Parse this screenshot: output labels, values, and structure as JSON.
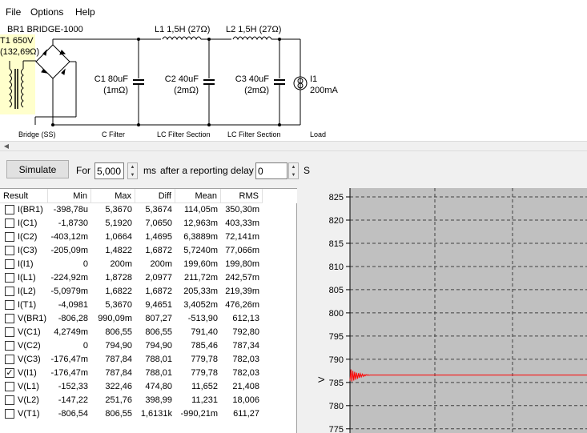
{
  "menu": {
    "file": "File",
    "options": "Options",
    "help": "Help"
  },
  "schematic": {
    "bridge_title": "BR1 BRIDGE-1000",
    "t1_label": "T1 650V",
    "t1_resistance": "(132,69Ω)",
    "l1_label": "L1 1,5H (27Ω)",
    "l2_label": "L2 1,5H (27Ω)",
    "c1_label": "C1 80uF",
    "c1_esr": "(1mΩ)",
    "c2_label": "C2 40uF",
    "c2_esr": "(2mΩ)",
    "c3_label": "C3 40uF",
    "c3_esr": "(2mΩ)",
    "i1_label": "I1",
    "i1_value": "200mA",
    "sections": {
      "bridge": "Bridge (SS)",
      "cfilter": "C Filter",
      "lc1": "LC Filter Section",
      "lc2": "LC Filter Section",
      "load": "Load"
    }
  },
  "sim": {
    "simulate_label": "Simulate",
    "for_label": "For",
    "duration": "5,000",
    "ms_label": "ms",
    "delay_label": "after a reporting delay of",
    "delay": "0",
    "s_label": "S"
  },
  "results": {
    "columns": [
      "Result",
      "Min",
      "Max",
      "Diff",
      "Mean",
      "RMS"
    ],
    "rows": [
      {
        "name": "I(BR1)",
        "checked": false,
        "min": "-398,78u",
        "max": "5,3670",
        "diff": "5,3674",
        "mean": "114,05m",
        "rms": "350,30m"
      },
      {
        "name": "I(C1)",
        "checked": false,
        "min": "-1,8730",
        "max": "5,1920",
        "diff": "7,0650",
        "mean": "12,963m",
        "rms": "403,33m"
      },
      {
        "name": "I(C2)",
        "checked": false,
        "min": "-403,12m",
        "max": "1,0664",
        "diff": "1,4695",
        "mean": "6,3889m",
        "rms": "72,141m"
      },
      {
        "name": "I(C3)",
        "checked": false,
        "min": "-205,09m",
        "max": "1,4822",
        "diff": "1,6872",
        "mean": "5,7240m",
        "rms": "77,066m"
      },
      {
        "name": "I(I1)",
        "checked": false,
        "min": "0",
        "max": "200m",
        "diff": "200m",
        "mean": "199,60m",
        "rms": "199,80m"
      },
      {
        "name": "I(L1)",
        "checked": false,
        "min": "-224,92m",
        "max": "1,8728",
        "diff": "2,0977",
        "mean": "211,72m",
        "rms": "242,57m"
      },
      {
        "name": "I(L2)",
        "checked": false,
        "min": "-5,0979m",
        "max": "1,6822",
        "diff": "1,6872",
        "mean": "205,33m",
        "rms": "219,39m"
      },
      {
        "name": "I(T1)",
        "checked": false,
        "min": "-4,0981",
        "max": "5,3670",
        "diff": "9,4651",
        "mean": "3,4052m",
        "rms": "476,26m"
      },
      {
        "name": "V(BR1)",
        "checked": false,
        "min": "-806,28",
        "max": "990,09m",
        "diff": "807,27",
        "mean": "-513,90",
        "rms": "612,13"
      },
      {
        "name": "V(C1)",
        "checked": false,
        "min": "4,2749m",
        "max": "806,55",
        "diff": "806,55",
        "mean": "791,40",
        "rms": "792,80"
      },
      {
        "name": "V(C2)",
        "checked": false,
        "min": "0",
        "max": "794,90",
        "diff": "794,90",
        "mean": "785,46",
        "rms": "787,34"
      },
      {
        "name": "V(C3)",
        "checked": false,
        "min": "-176,47m",
        "max": "787,84",
        "diff": "788,01",
        "mean": "779,78",
        "rms": "782,03"
      },
      {
        "name": "V(I1)",
        "checked": true,
        "min": "-176,47m",
        "max": "787,84",
        "diff": "788,01",
        "mean": "779,78",
        "rms": "782,03"
      },
      {
        "name": "V(L1)",
        "checked": false,
        "min": "-152,33",
        "max": "322,46",
        "diff": "474,80",
        "mean": "11,652",
        "rms": "21,408"
      },
      {
        "name": "V(L2)",
        "checked": false,
        "min": "-147,22",
        "max": "251,76",
        "diff": "398,99",
        "mean": "11,231",
        "rms": "18,006"
      },
      {
        "name": "V(T1)",
        "checked": false,
        "min": "-806,54",
        "max": "806,55",
        "diff": "1,6131k",
        "mean": "-990,21m",
        "rms": "611,27"
      }
    ]
  },
  "chart_data": {
    "type": "line",
    "ylabel": "V",
    "yticks": [
      825,
      820,
      815,
      810,
      805,
      800,
      795,
      790,
      785,
      780,
      775
    ],
    "ylim": [
      775,
      826
    ],
    "grid": true,
    "series": [
      {
        "color": "#ff0000",
        "x": [
          0,
          0.4,
          0.8,
          1.2,
          1.6,
          2.0,
          2.4,
          2.8,
          3.2,
          3.6,
          4.0,
          4.4,
          4.8,
          5.2,
          5.6,
          6.0,
          6.4,
          6.8,
          7.2,
          7.6,
          8.0,
          8.4,
          8.8,
          9.2,
          9.6,
          10.0,
          10.4,
          10.8,
          11.2,
          11.6,
          12.0,
          12.4,
          12.8,
          13.2,
          13.6,
          14.0,
          15.0,
          20,
          30,
          40,
          50,
          60,
          70,
          80,
          90,
          100
        ],
        "y": [
          785.4,
          787.8,
          785.2,
          787.5,
          785.4,
          787.3,
          785.6,
          787.1,
          785.8,
          787.0,
          786.0,
          786.9,
          786.2,
          786.8,
          786.3,
          786.7,
          786.4,
          786.7,
          786.5,
          786.7,
          786.5,
          786.6,
          786.6,
          786.6,
          786.6,
          786.6,
          786.6,
          786.6,
          786.6,
          786.6,
          786.6,
          786.6,
          786.6,
          786.6,
          786.6,
          786.6,
          786.6,
          786.6,
          786.6,
          786.6,
          786.6,
          786.6,
          786.6,
          786.6,
          786.6,
          786.6
        ]
      }
    ]
  }
}
